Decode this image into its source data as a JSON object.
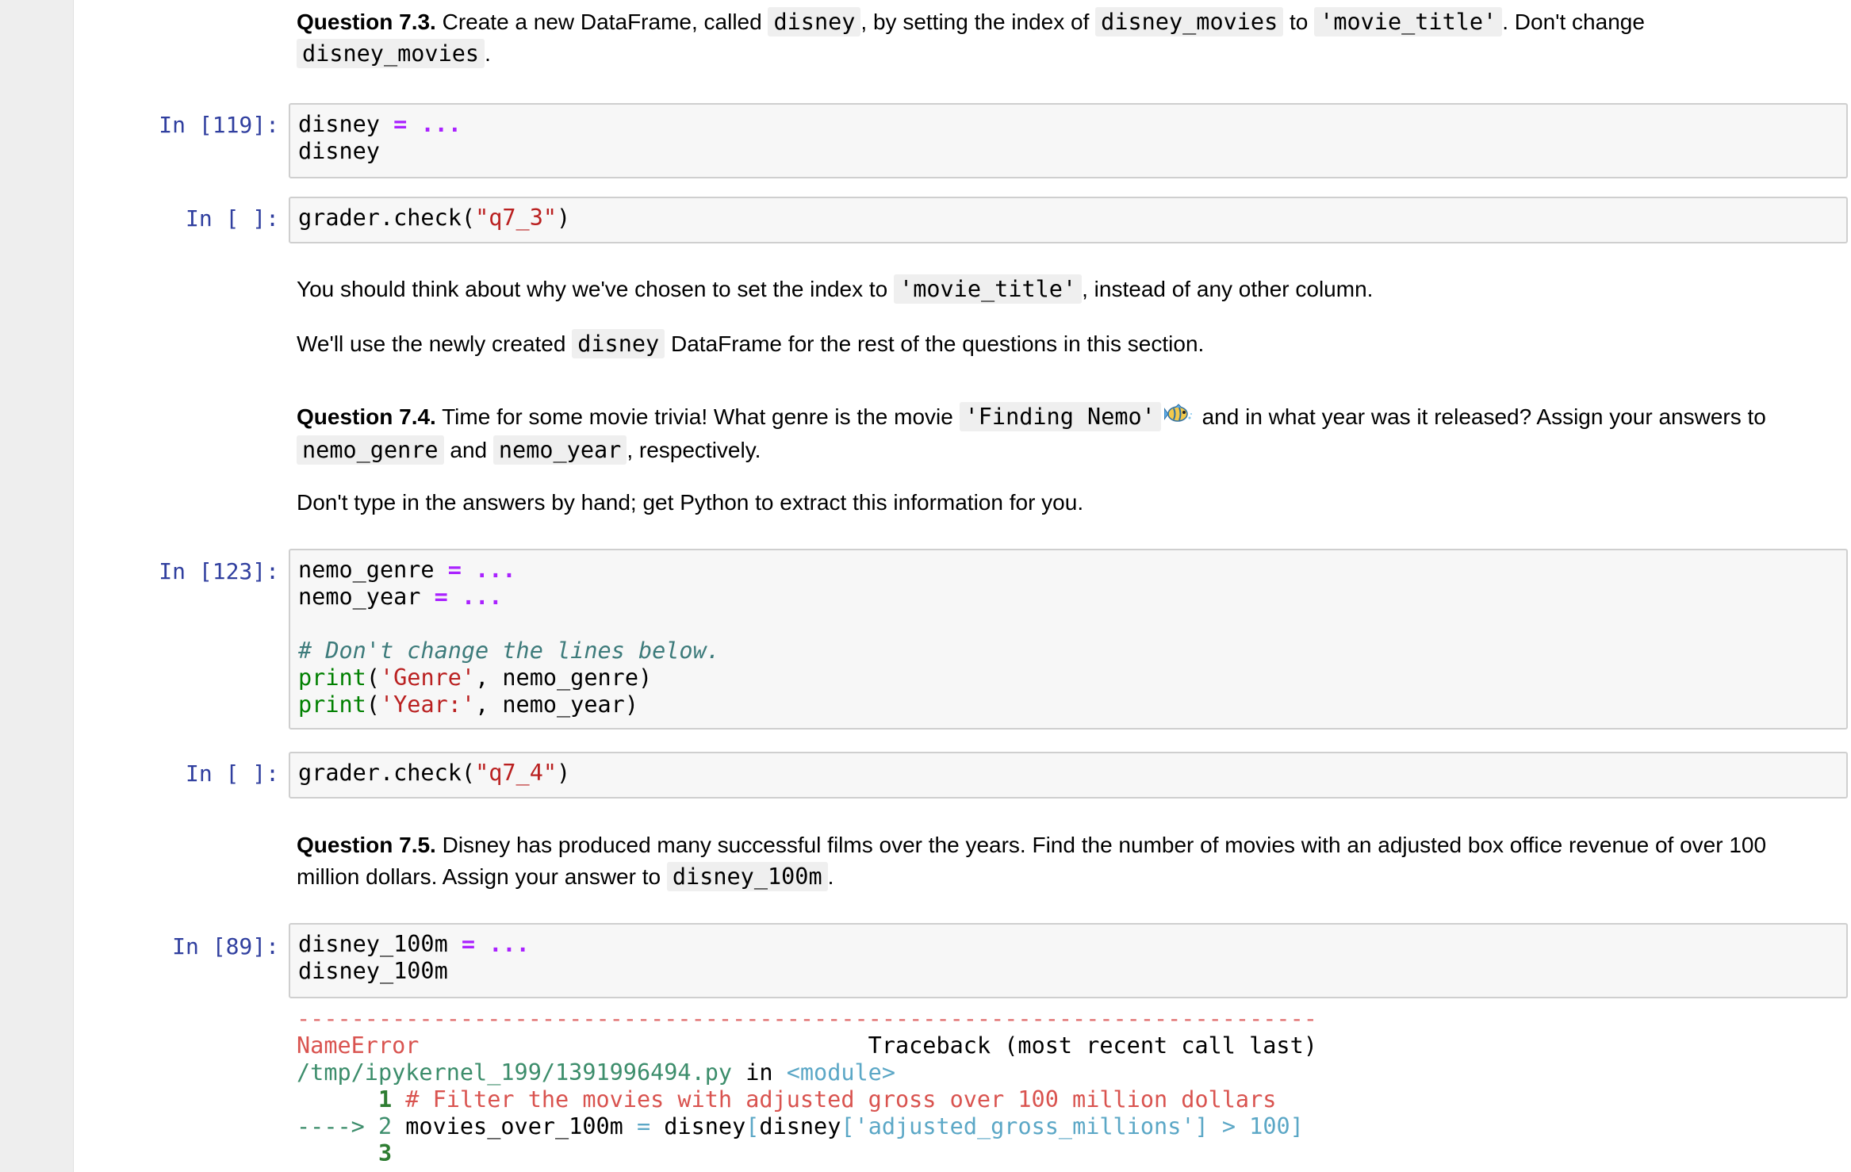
{
  "q73": {
    "label": "Question 7.3.",
    "t1": " Create a new DataFrame, called ",
    "c1": "disney",
    "t2": ", by setting the index of ",
    "c2": "disney_movies",
    "t3": " to ",
    "c3": "'movie_title'",
    "t4": ". Don't change",
    "c4": "disney_movies",
    "t5": "."
  },
  "cell1": {
    "prompt": "In [119]:",
    "l1a": "disney ",
    "l1op": "=",
    "l1b": " ",
    "l1dots": "...",
    "l2": "disney"
  },
  "cell2": {
    "prompt": "In [ ]:",
    "pre": "grader.check(",
    "str": "\"q7_3\"",
    "post": ")"
  },
  "md2": {
    "t1": "You should think about why we've chosen to set the index to ",
    "c1": "'movie_title'",
    "t2": ", instead of any other column.",
    "t3": "We'll use the newly created ",
    "c2": "disney",
    "t4": " DataFrame for the rest of the questions in this section."
  },
  "q74": {
    "label": "Question 7.4.",
    "t1": " Time for some movie trivia! What genre is the movie ",
    "c1": "'Finding Nemo'",
    "t2": " and in what year was it released? Assign your answers to",
    "c2": "nemo_genre",
    "t3": " and ",
    "c3": "nemo_year",
    "t4": ", respectively.",
    "t5": "Don't type in the answers by hand; get Python to extract this information for you."
  },
  "cell3": {
    "prompt": "In [123]:",
    "l1a": "nemo_genre ",
    "l2a": "nemo_year ",
    "eq": "=",
    "dots": "...",
    "comment": "# Don't change the lines below.",
    "print": "print",
    "s1": "'Genre'",
    "r1": ", nemo_genre)",
    "s2": "'Year:'",
    "r2": ", nemo_year)",
    "paren": "("
  },
  "cell4": {
    "prompt": "In [ ]:",
    "pre": "grader.check(",
    "str": "\"q7_4\"",
    "post": ")"
  },
  "q75": {
    "label": "Question 7.5.",
    "t1": " Disney has produced many successful films over the years. Find the number of movies with an adjusted box office revenue of over 100",
    "t2": "million dollars. Assign your answer to ",
    "c1": "disney_100m",
    "t3": "."
  },
  "cell5": {
    "prompt": "In [89]:",
    "l1a": "disney_100m ",
    "eq": "=",
    "dots": "...",
    "l2": "disney_100m"
  },
  "traceback": {
    "dashes": "---------------------------------------------------------------------------",
    "err_name": "NameError",
    "header_gap": "                                 ",
    "header": "Traceback (most recent call last)",
    "file": "/tmp/ipykernel_199/1391996494.py",
    "in": " in ",
    "module": "<module>",
    "ln1_num": "      1",
    "ln1_text": " # Filter the movies with adjusted gross over 100 million dollars",
    "arrow": "----> 2",
    "ln2_a": " movies_over_100m ",
    "ln2_eq": "=",
    "ln2_b": " disney",
    "ln2_c": "[",
    "ln2_d": "disney",
    "ln2_e": "[",
    "ln2_str": "'adjusted_gross_millions'",
    "ln2_f": "]",
    "ln2_gt": " > ",
    "ln2_num": "100",
    "ln2_g": "]",
    "ln3_num": "      3"
  }
}
